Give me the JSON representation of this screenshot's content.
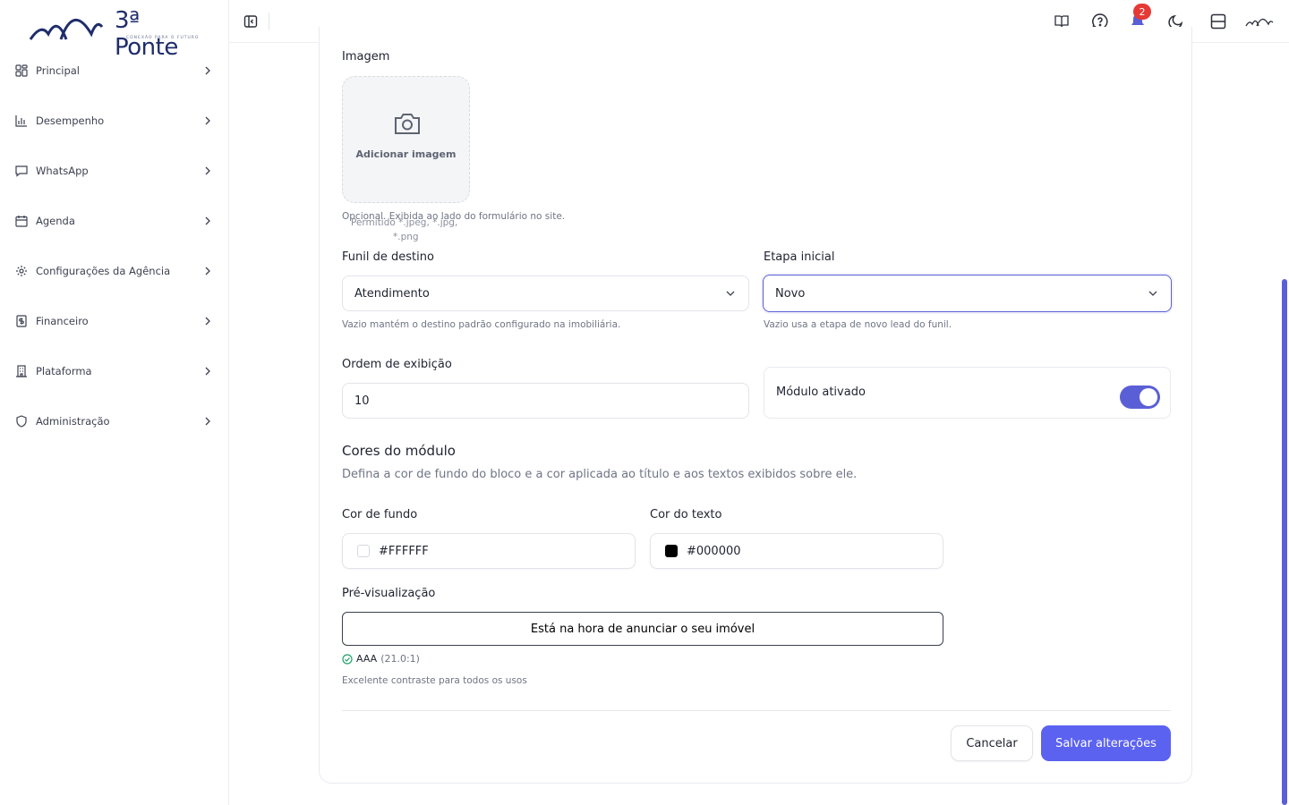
{
  "brand": {
    "name": "3ª Ponte",
    "tagline": "CONEXÃO PARA O FUTURO"
  },
  "sidebar": {
    "items": [
      {
        "label": "Principal",
        "icon": "grid-icon"
      },
      {
        "label": "Desempenho",
        "icon": "bar-chart-icon"
      },
      {
        "label": "WhatsApp",
        "icon": "chat-icon"
      },
      {
        "label": "Agenda",
        "icon": "calendar-icon"
      },
      {
        "label": "Configurações da Agência",
        "icon": "gear-icon"
      },
      {
        "label": "Financeiro",
        "icon": "dollar-receipt-icon"
      },
      {
        "label": "Plataforma",
        "icon": "building-icon"
      },
      {
        "label": "Administração",
        "icon": "shield-icon"
      }
    ]
  },
  "topbar": {
    "notification_count": "2"
  },
  "form": {
    "image": {
      "label": "Imagem",
      "add_label": "Adicionar imagem",
      "hint": "Opcional. Exibida ao lado do formulário no site.",
      "allowed_prefix": "Permitido *.jpeg, *.jpg,",
      "allowed_suffix": "*.png"
    },
    "funnel": {
      "label": "Funil de destino",
      "value": "Atendimento",
      "hint": "Vazio mantém o destino padrão configurado na imobiliária."
    },
    "stage": {
      "label": "Etapa inicial",
      "value": "Novo",
      "hint": "Vazio usa a etapa de novo lead do funil."
    },
    "order": {
      "label": "Ordem de exibição",
      "value": "10"
    },
    "module_toggle": {
      "label": "Módulo ativado",
      "enabled": true
    },
    "colors": {
      "title": "Cores do módulo",
      "subtitle": "Defina a cor de fundo do bloco e a cor aplicada ao título e aos textos exibidos sobre ele.",
      "background": {
        "label": "Cor de fundo",
        "value": "#FFFFFF"
      },
      "text": {
        "label": "Cor do texto",
        "value": "#000000"
      }
    },
    "preview": {
      "label": "Pré-visualização",
      "text": "Está na hora de anunciar o seu imóvel",
      "level": "AAA",
      "ratio": "(21.0:1)",
      "message": "Excelente contraste para todos os usos"
    },
    "actions": {
      "cancel": "Cancelar",
      "save": "Salvar alterações"
    }
  },
  "colors": {
    "accent": "#5b5fd6",
    "save_button": "#5b62f0",
    "badge": "#e53935",
    "success": "#22a06b"
  }
}
